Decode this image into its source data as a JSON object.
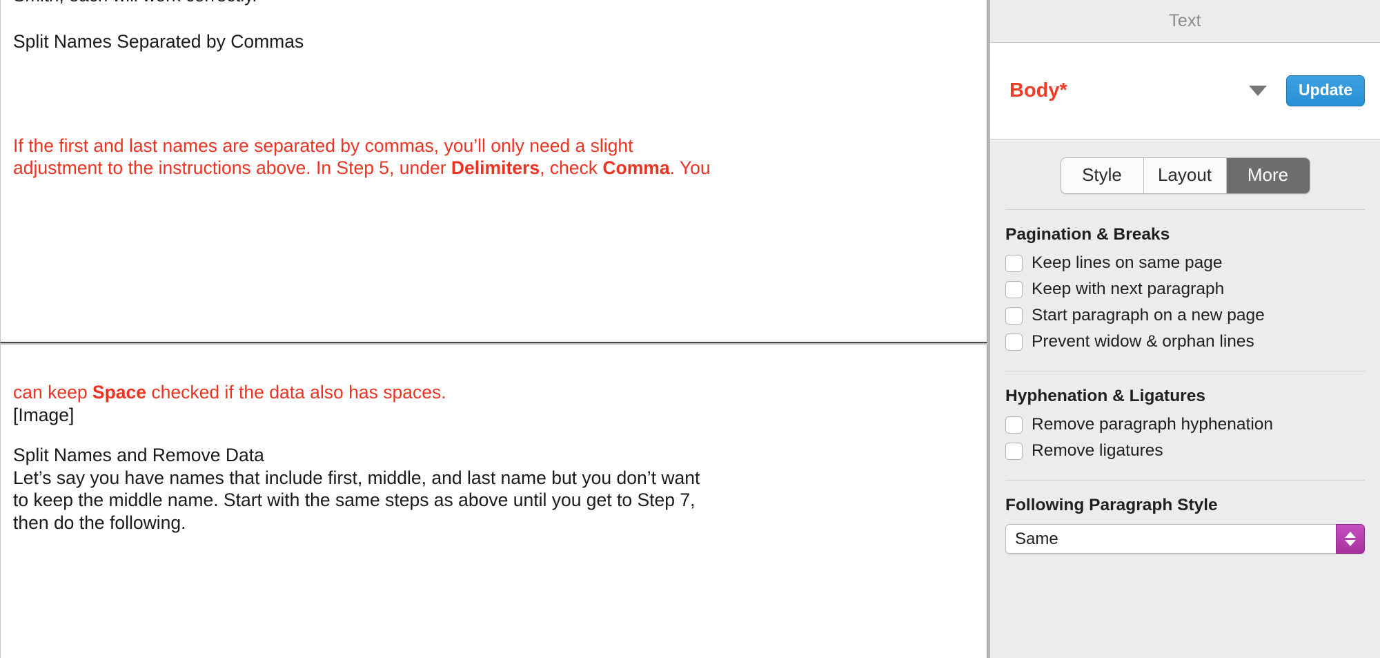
{
  "document": {
    "clipped_top_line": "Smith, each will work correctly.",
    "page_one": {
      "heading": "Split Names Separated by Commas",
      "red_paragraph": {
        "line1": "If the first and last names are separated by commas, you’ll only need a slight",
        "line2_a": "adjustment to the instructions above. In Step 5, under ",
        "line2_bold1": "Delimiters",
        "line2_b": ", check ",
        "line2_bold2": "Comma",
        "line2_c": ". You"
      }
    },
    "page_two": {
      "red_continuation_a": "can keep ",
      "red_continuation_bold": "Space",
      "red_continuation_b": " checked if the data also has spaces.",
      "image_placeholder": "[Image]",
      "heading": "Split Names and Remove Data",
      "paragraph_lines": [
        "Let’s say you have names that include first, middle, and last name but you don’t want",
        "to keep the middle name. Start with the same steps as above until you get to Step 7,",
        "then do the following."
      ]
    }
  },
  "inspector": {
    "title": "Text",
    "style_name": "Body*",
    "disclosure_icon": "triangle-down-icon",
    "update_label": "Update",
    "tabs": [
      {
        "label": "Style",
        "selected": false
      },
      {
        "label": "Layout",
        "selected": false
      },
      {
        "label": "More",
        "selected": true
      }
    ],
    "pagination": {
      "title": "Pagination & Breaks",
      "options": [
        {
          "label": "Keep lines on same page",
          "checked": false
        },
        {
          "label": "Keep with next paragraph",
          "checked": false
        },
        {
          "label": "Start paragraph on a new page",
          "checked": false
        },
        {
          "label": "Prevent widow & orphan lines",
          "checked": false
        }
      ]
    },
    "hyphenation": {
      "title": "Hyphenation & Ligatures",
      "options": [
        {
          "label": "Remove paragraph hyphenation",
          "checked": false
        },
        {
          "label": "Remove ligatures",
          "checked": false
        }
      ]
    },
    "following_style": {
      "title": "Following Paragraph Style",
      "value": "Same",
      "stepper_icon": "stepper-updown-icon"
    }
  },
  "colors": {
    "accent_red": "#ec3323",
    "update_blue": "#2790d7",
    "selected_tab_gray": "#6e6e6e",
    "stepper_purple": "#a8309f",
    "panel_bg": "#ececec"
  }
}
